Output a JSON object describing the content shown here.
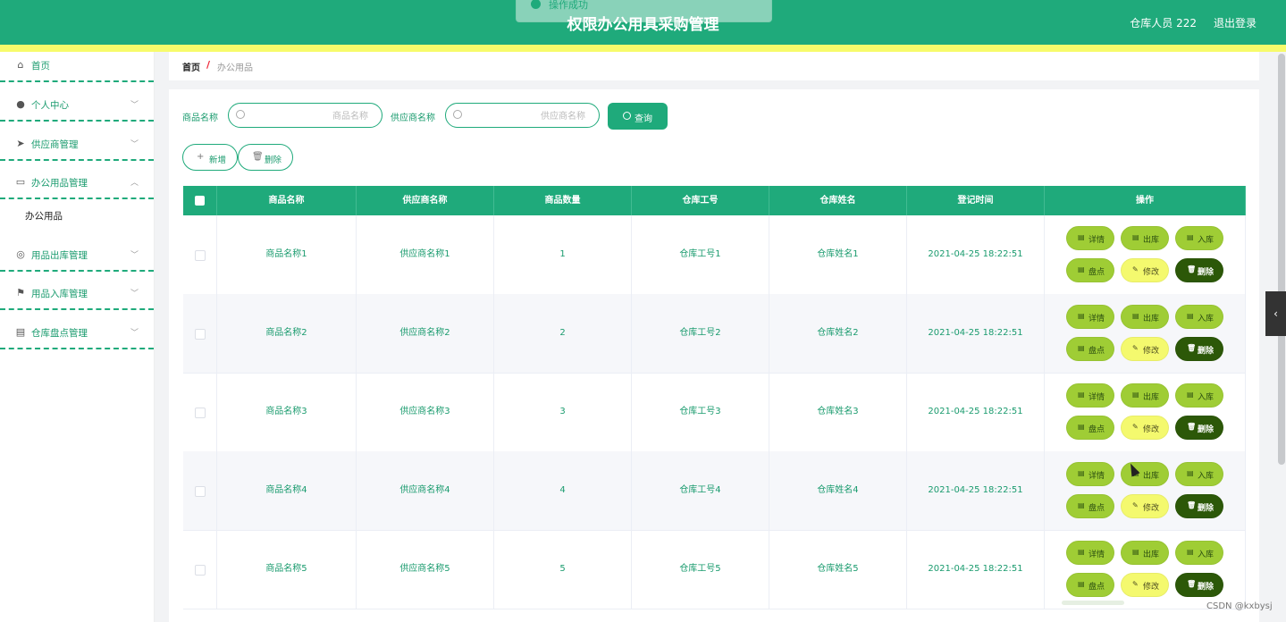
{
  "header": {
    "title": "权限办公用具采购管理",
    "user": "仓库人员 222",
    "logout": "退出登录",
    "toast": "操作成功",
    "colors": {
      "primary": "#1faa7b",
      "accent_strip": "#f7fb6b"
    }
  },
  "sidebar": {
    "items": [
      {
        "label": "首页",
        "icon": "home-icon",
        "glyph": "⌂",
        "arrow": ""
      },
      {
        "label": "个人中心",
        "icon": "user-icon",
        "glyph": "●",
        "arrow": "﹀"
      },
      {
        "label": "供应商管理",
        "icon": "send-icon",
        "glyph": "➤",
        "arrow": "﹀"
      },
      {
        "label": "办公用品管理",
        "icon": "briefcase-icon",
        "glyph": "▭",
        "arrow": "︿"
      },
      {
        "label": "用品出库管理",
        "icon": "compass-icon",
        "glyph": "◎",
        "arrow": "﹀"
      },
      {
        "label": "用品入库管理",
        "icon": "flag-icon",
        "glyph": "⚑",
        "arrow": "﹀"
      },
      {
        "label": "仓库盘点管理",
        "icon": "clipboard-icon",
        "glyph": "▤",
        "arrow": "﹀"
      }
    ],
    "submenu": {
      "label": "办公用品"
    }
  },
  "breadcrumb": {
    "home": "首页",
    "separator": "/",
    "current": "办公用品"
  },
  "search": {
    "name_label": "商品名称",
    "name_placeholder": "商品名称",
    "supplier_label": "供应商名称",
    "supplier_placeholder": "供应商名称",
    "query_label": "查询"
  },
  "toolbar": {
    "add_label": "新增",
    "add_icon": "+",
    "delete_label": "删除",
    "delete_icon": "🗑"
  },
  "table": {
    "headers": [
      "商品名称",
      "供应商名称",
      "商品数量",
      "仓库工号",
      "仓库姓名",
      "登记时间",
      "操作"
    ],
    "rows": [
      [
        "商品名称1",
        "供应商名称1",
        "1",
        "仓库工号1",
        "仓库姓名1",
        "2021-04-25 18:22:51"
      ],
      [
        "商品名称2",
        "供应商名称2",
        "2",
        "仓库工号2",
        "仓库姓名2",
        "2021-04-25 18:22:51"
      ],
      [
        "商品名称3",
        "供应商名称3",
        "3",
        "仓库工号3",
        "仓库姓名3",
        "2021-04-25 18:22:51"
      ],
      [
        "商品名称4",
        "供应商名称4",
        "4",
        "仓库工号4",
        "仓库姓名4",
        "2021-04-25 18:22:51"
      ],
      [
        "商品名称5",
        "供应商名称5",
        "5",
        "仓库工号5",
        "仓库姓名5",
        "2021-04-25 18:22:51"
      ]
    ],
    "actions": [
      {
        "label": "详情",
        "icon": "▤",
        "style": "green"
      },
      {
        "label": "出库",
        "icon": "▤",
        "style": "green"
      },
      {
        "label": "入库",
        "icon": "▤",
        "style": "green"
      },
      {
        "label": "盘点",
        "icon": "▤",
        "style": "green"
      },
      {
        "label": "修改",
        "icon": "✎",
        "style": "yellow"
      },
      {
        "label": "删除",
        "icon": "🗑",
        "style": "dark"
      }
    ]
  },
  "side_tab": {
    "glyph": "‹"
  },
  "watermark": "CSDN @kxbysj"
}
